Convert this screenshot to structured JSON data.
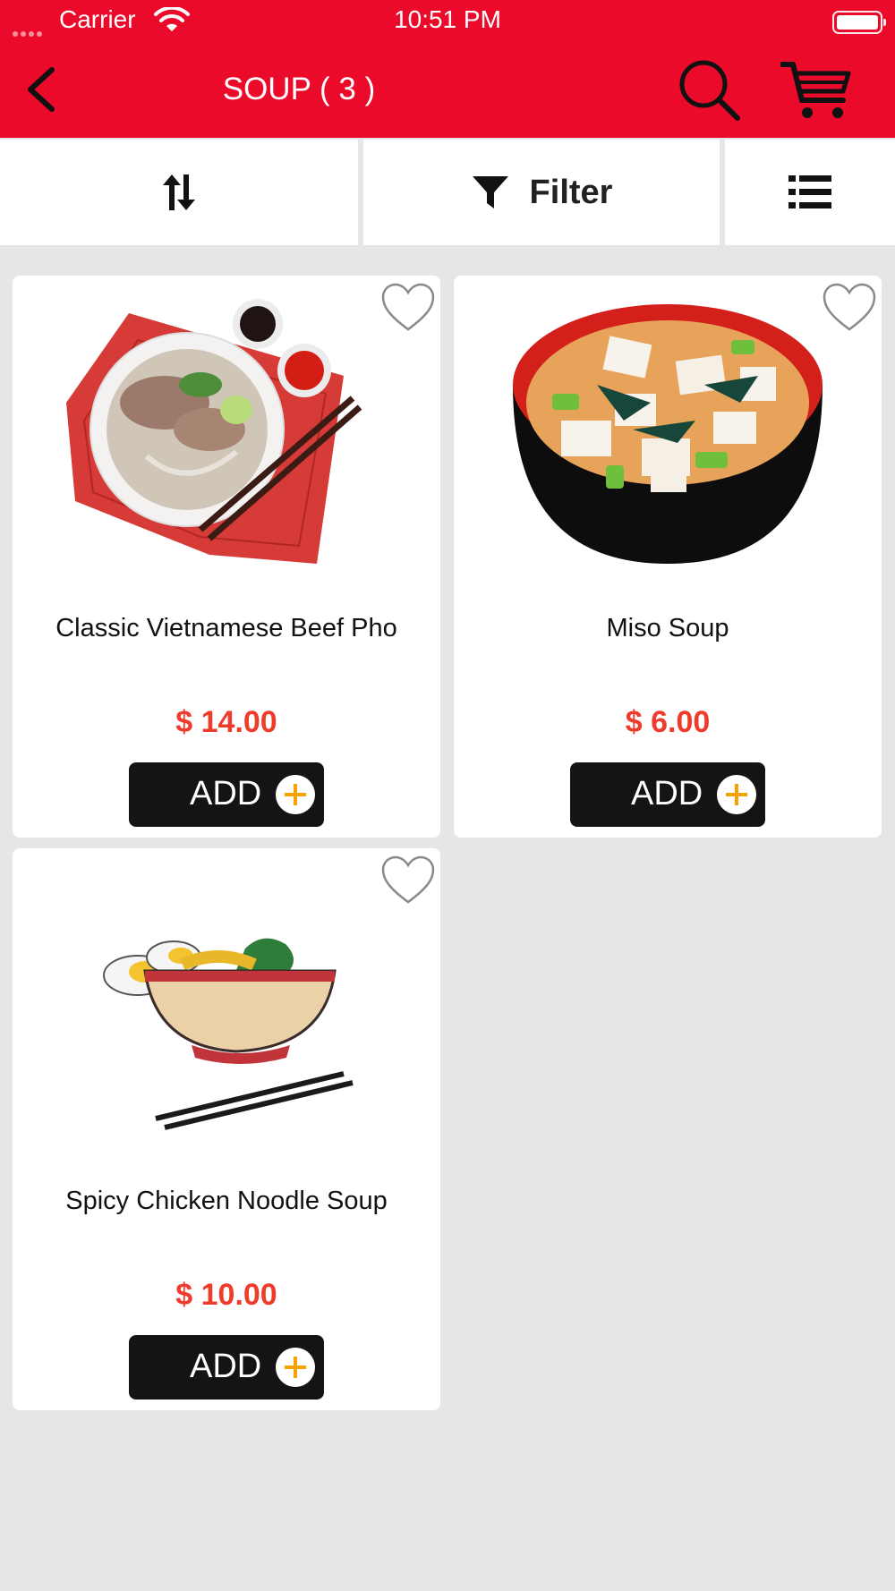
{
  "status_bar": {
    "carrier": "Carrier",
    "time": "10:51 PM"
  },
  "header": {
    "title": "SOUP ( 3 )",
    "back_icon": "chevron-left-icon",
    "search_icon": "search-icon",
    "cart_icon": "cart-icon"
  },
  "toolbar": {
    "sort_icon": "sort-arrows-icon",
    "filter_label": "Filter",
    "filter_icon": "funnel-icon",
    "view_icon": "list-view-icon"
  },
  "products": [
    {
      "name": "Classic Vietnamese Beef Pho",
      "price": "$ 14.00",
      "add_label": "ADD",
      "image": "beef-pho-bowl"
    },
    {
      "name": "Miso Soup",
      "price": "$ 6.00",
      "add_label": "ADD",
      "image": "miso-soup-bowl"
    },
    {
      "name": "Spicy Chicken Noodle Soup",
      "price": "$ 10.00",
      "add_label": "ADD",
      "image": "noodle-soup-illustration"
    }
  ],
  "colors": {
    "brand_red": "#ec0a2b",
    "price_red": "#ef3b2c",
    "add_button": "#141414",
    "plus_orange": "#f5a300",
    "background": "#e6e6e6"
  }
}
